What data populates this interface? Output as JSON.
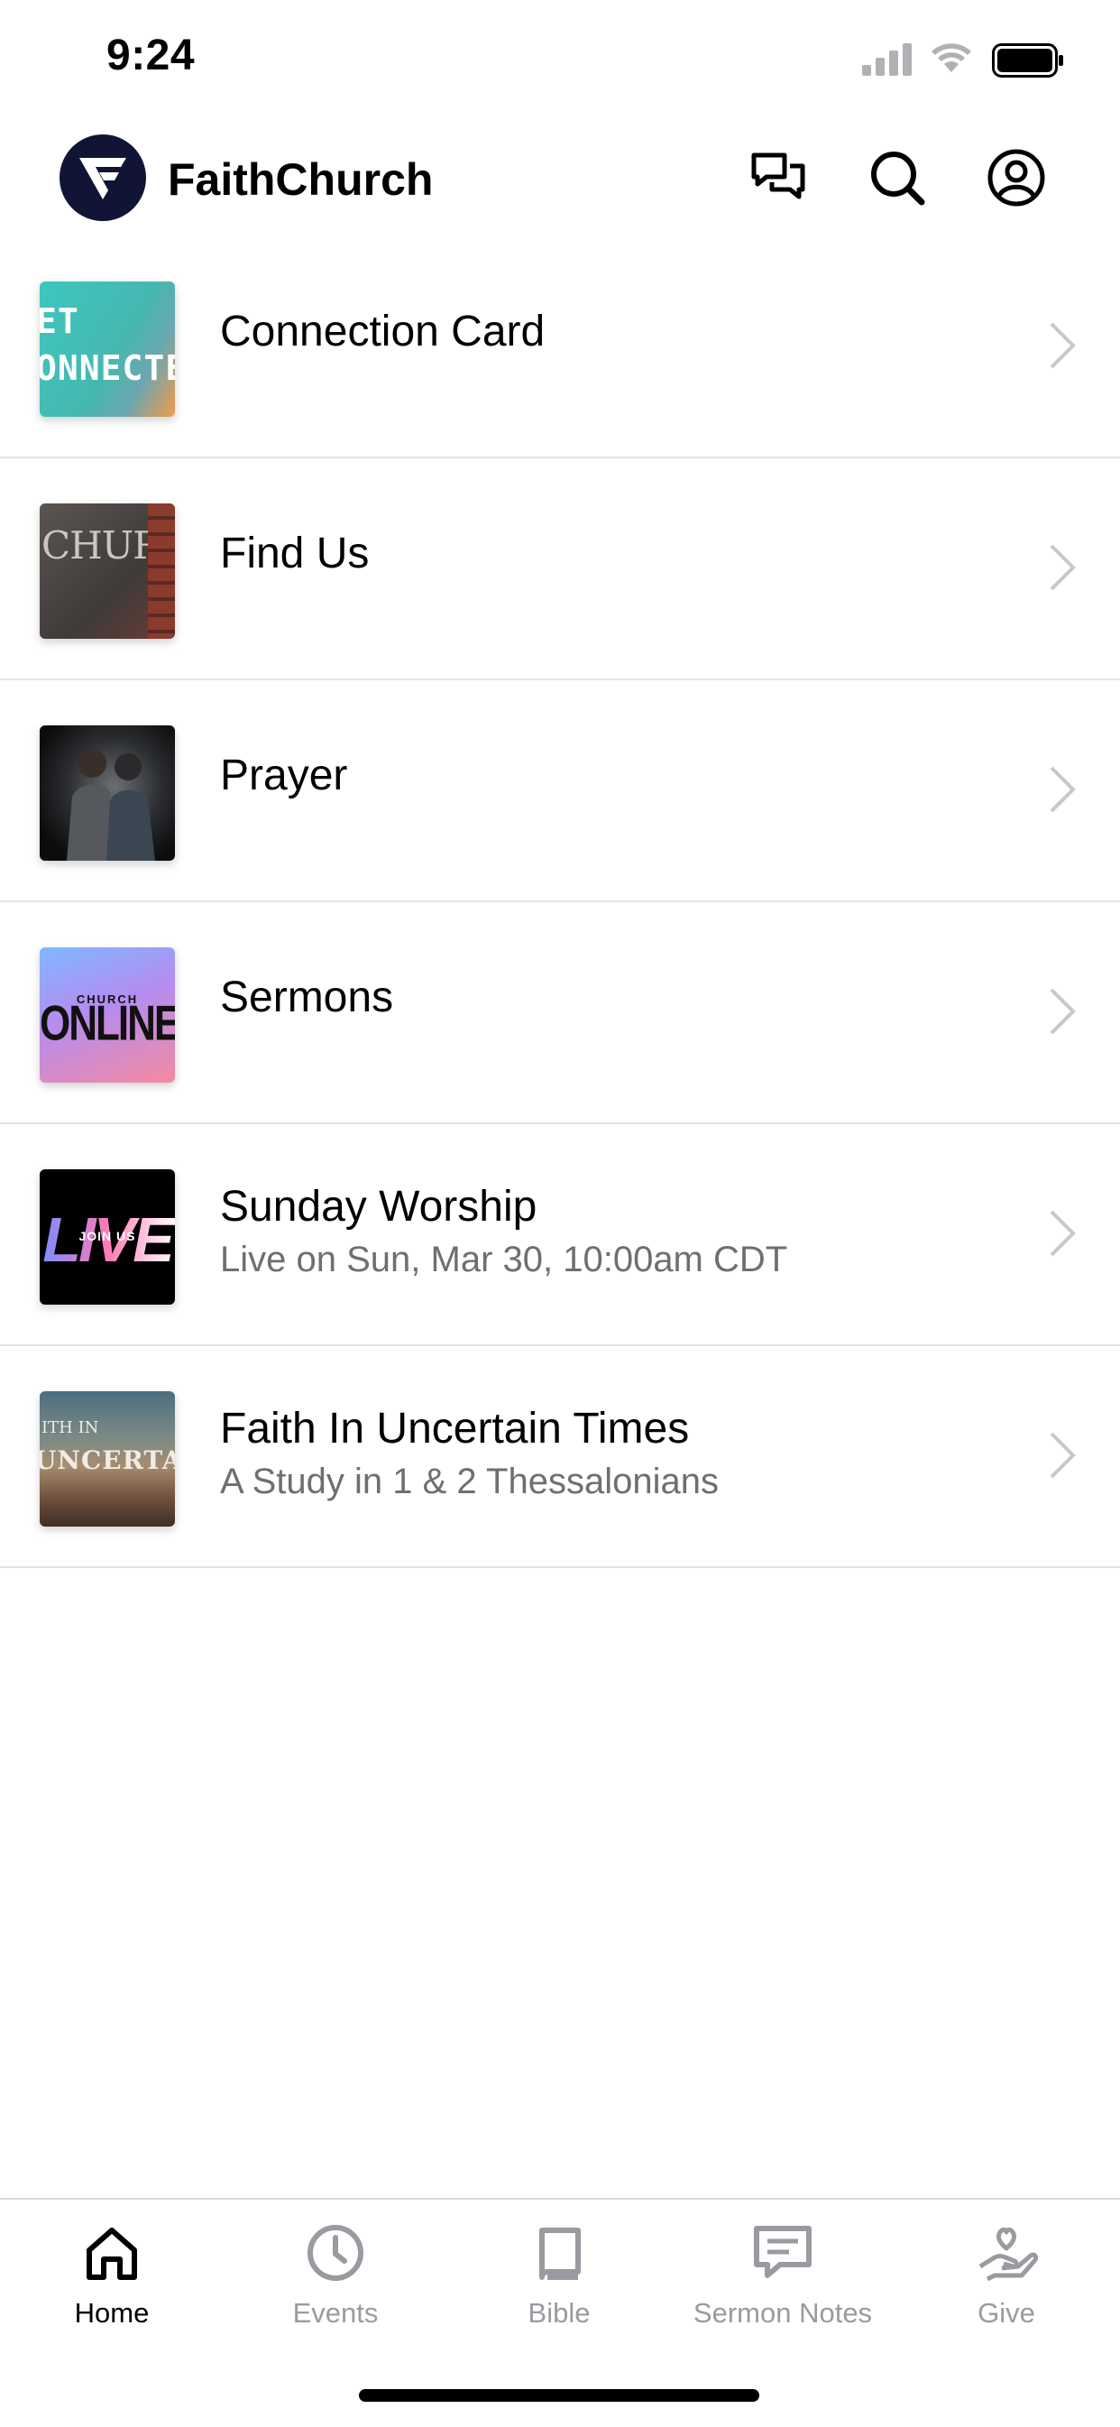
{
  "status_bar": {
    "time": "9:24"
  },
  "header": {
    "title": "FaithChurch"
  },
  "thumbnail_text": {
    "connection_line1": "ET",
    "connection_line2": "ONNECTE",
    "find_us": "CHURCH",
    "sermons_small": "CHURCH",
    "sermons_big": "ONLINE",
    "live_big": "LIVE",
    "live_small": "JOIN US",
    "faith_top": "ITH IN",
    "faith_main": "UNCERTAIN"
  },
  "list": [
    {
      "title": "Connection Card",
      "subtitle": ""
    },
    {
      "title": "Find Us",
      "subtitle": ""
    },
    {
      "title": "Prayer",
      "subtitle": ""
    },
    {
      "title": "Sermons",
      "subtitle": ""
    },
    {
      "title": "Sunday Worship",
      "subtitle": "Live on Sun, Mar 30, 10:00am CDT"
    },
    {
      "title": "Faith In Uncertain Times",
      "subtitle": "A Study in 1 & 2 Thessalonians"
    }
  ],
  "tabs": [
    {
      "label": "Home",
      "icon": "home-icon",
      "active": true
    },
    {
      "label": "Events",
      "icon": "clock-icon",
      "active": false
    },
    {
      "label": "Bible",
      "icon": "book-icon",
      "active": false
    },
    {
      "label": "Sermon Notes",
      "icon": "notes-icon",
      "active": false
    },
    {
      "label": "Give",
      "icon": "give-icon",
      "active": false
    }
  ],
  "colors": {
    "logo_bg": "#101536",
    "inactive_tab": "#9a9aa0",
    "divider": "#e3e3e6",
    "subtitle": "#6e6e73"
  }
}
